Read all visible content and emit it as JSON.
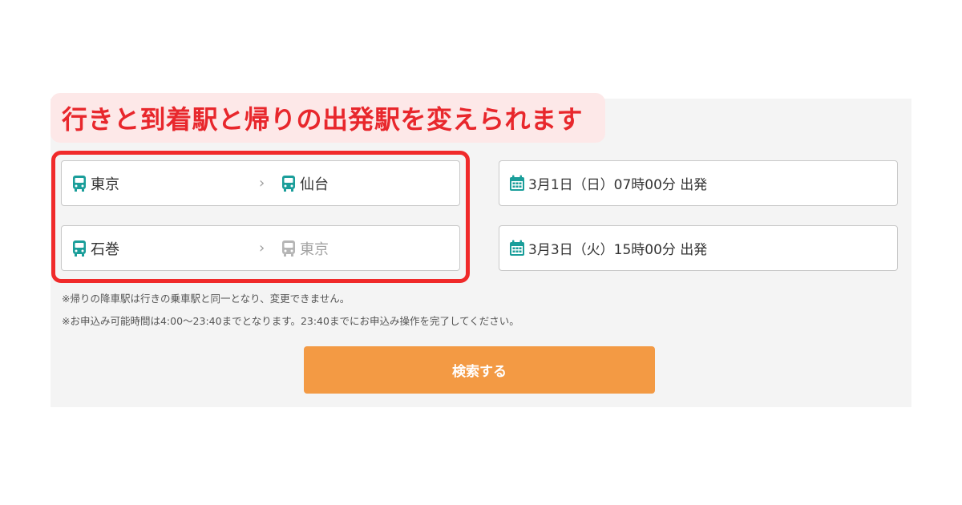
{
  "banner": {
    "text": "行きと到着駅と帰りの出発駅を変えられます"
  },
  "outbound": {
    "from": "東京",
    "to": "仙台"
  },
  "return_trip": {
    "from": "石巻",
    "to": "東京"
  },
  "outbound_date": {
    "text": "3月1日（日）07時00分 出発"
  },
  "return_date": {
    "text": "3月3日（火）15時00分 出発"
  },
  "notes": [
    "※帰りの降車駅は行きの乗車駅と同一となり、変更できません。",
    "※お申込み可能時間は4:00〜23:40までとなります。23:40までにお申込み操作を完了してください。"
  ],
  "search_button": {
    "label": "検索する"
  },
  "colors": {
    "accent": "#f39a44",
    "highlight": "#f02a2a",
    "banner_text": "#e8272c",
    "banner_bg": "#fde8e8",
    "icon_teal": "#1a9e9a",
    "icon_disabled": "#b5b5b5"
  },
  "icons": {
    "station": "bus-icon",
    "date": "calendar-icon",
    "separator": "chevron-right-icon"
  }
}
